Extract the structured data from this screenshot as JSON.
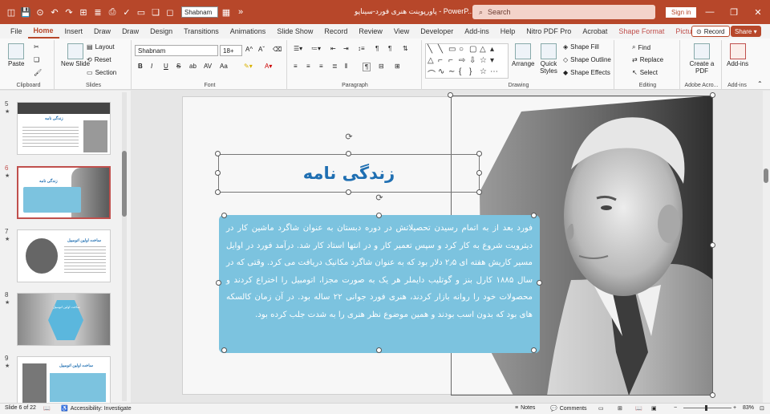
{
  "titlebar": {
    "font_name": "Shabnam",
    "doc_title": "پاورپوینت هنری فورد-سیناپو - PowerP...",
    "search_placeholder": "Search",
    "signin": "Sign in",
    "minimize": "—",
    "restore": "❐",
    "close": "✕"
  },
  "menu": {
    "tabs": [
      "File",
      "Home",
      "Insert",
      "Draw",
      "Draw",
      "Design",
      "Transitions",
      "Animations",
      "Slide Show",
      "Record",
      "Review",
      "View",
      "Developer",
      "Add-ins",
      "Help",
      "Nitro PDF Pro",
      "Acrobat",
      "Shape Format",
      "Picture Format"
    ],
    "record": "Record",
    "share": "Share"
  },
  "ribbon": {
    "clipboard": {
      "label": "Clipboard",
      "paste": "Paste"
    },
    "slides": {
      "label": "Slides",
      "new_slide": "New Slide",
      "layout": "Layout",
      "reset": "Reset",
      "section": "Section"
    },
    "font": {
      "label": "Font",
      "font_name": "Shabnam",
      "font_size": "18+",
      "bold": "B",
      "italic": "I",
      "underline": "U",
      "strike": "S",
      "ab": "ab",
      "av": "AV",
      "aa": "Aa"
    },
    "paragraph": {
      "label": "Paragraph"
    },
    "drawing": {
      "label": "Drawing",
      "arrange": "Arrange",
      "quick_styles": "Quick Styles",
      "shape_fill": "Shape Fill",
      "shape_outline": "Shape Outline",
      "shape_effects": "Shape Effects"
    },
    "editing": {
      "label": "Editing",
      "find": "Find",
      "replace": "Replace",
      "select": "Select"
    },
    "adobe": {
      "label": "Adobe Acro...",
      "create_pdf": "Create a PDF"
    },
    "addins": {
      "label": "Add-ins",
      "addins": "Add-ins"
    }
  },
  "thumbnails": [
    {
      "num": "5",
      "star": "★",
      "title": "زندگی نامه"
    },
    {
      "num": "6",
      "star": "★",
      "title": "زندگی نامه"
    },
    {
      "num": "7",
      "star": "★",
      "title": "ساخت اولین اتومبیل"
    },
    {
      "num": "8",
      "star": "★",
      "title": "ساخت اولین اتومبیل"
    },
    {
      "num": "9",
      "star": "★",
      "title": "ساخت اولین اتومبیل"
    }
  ],
  "slide": {
    "title": "زندگی نامه",
    "body": "فورد بعد از به اتمام رسیدن تحصیلاتش در دوره دبستان به عنوان شاگرد ماشین کار در دیترویت شروع به کار کرد و سپس تعمیر کار و در انتها استاد کار شد. درآمد فورد در اوایل مسیر کاریش هفته ای ۲٫۵ دلار بود که به عنوان شاگرد مکانیک دریافت می کرد. وقتی که در سال ۱۸۸۵ کارل بنز و گوتلیب دایملر هر یک به صورت مجزا، اتومبیل را اختراع کردند و محصولات خود را روانه بازار کردند، هنری فورد جوانی ۲۲ ساله بود. در آن زمان کالسکه های بود که بدون اسب بودند و همین موضوع نظر هنری را به شدت جلب کرده بود."
  },
  "statusbar": {
    "slide_of": "Slide 6 of 22",
    "accessibility": "Accessibility: Investigate",
    "notes": "Notes",
    "comments": "Comments",
    "zoom": "83%"
  },
  "colors": {
    "accent": "#b7472a",
    "body_box": "#7cc3df",
    "title": "#1f6fb2"
  }
}
